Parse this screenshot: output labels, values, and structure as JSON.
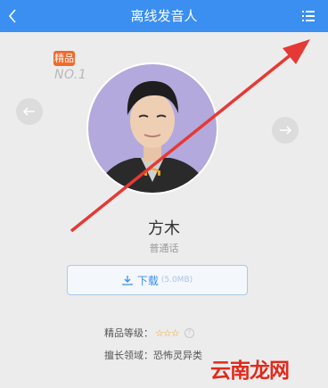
{
  "header": {
    "title": "离线发音人",
    "back_icon": "chevron-left-icon",
    "menu_icon": "menu-icon"
  },
  "voice": {
    "badge": "精品",
    "rank": "NO.1",
    "name": "方木",
    "language": "普通话",
    "download_label": "下载",
    "download_size": "(5.0MB)",
    "quality_label": "精品等级：",
    "quality_stars": "☆☆☆",
    "specialty_label": "擅长领域：",
    "specialty_value": "恐怖灵异类"
  },
  "watermark": "云南龙网",
  "colors": {
    "header": "#3a8ff0",
    "badge": "#f06a2b",
    "annotation_arrow": "#e53935",
    "watermark": "#e02a1c",
    "star": "#f2a21a"
  }
}
